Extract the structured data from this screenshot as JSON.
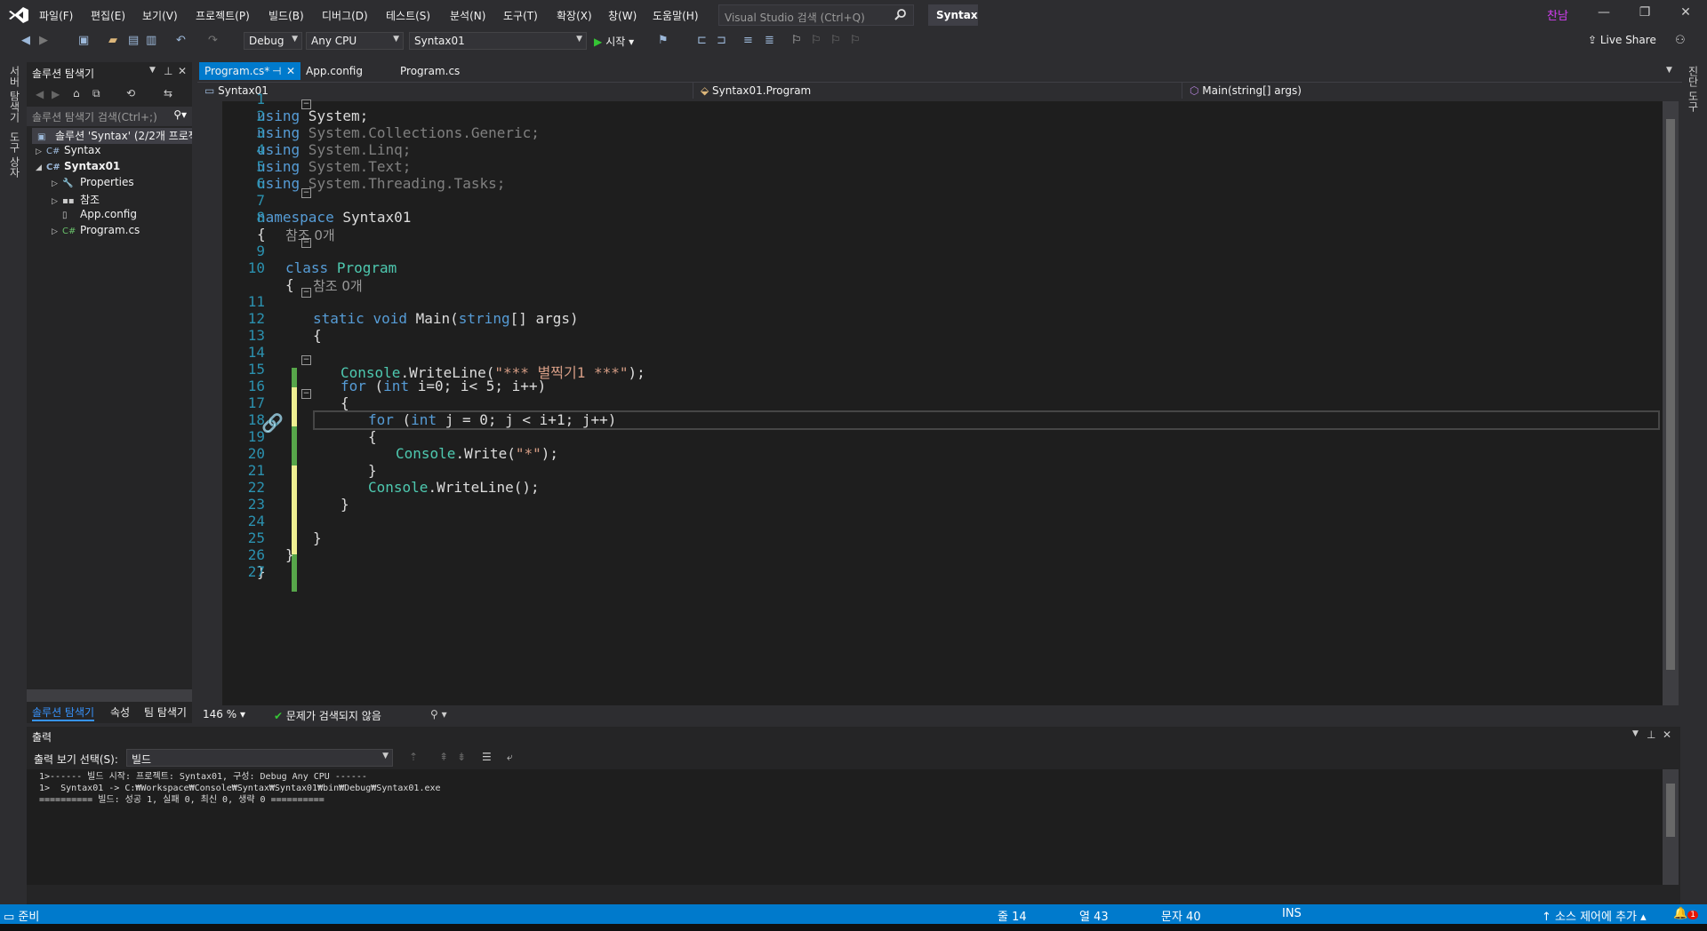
{
  "menu": [
    "파일(F)",
    "편집(E)",
    "보기(V)",
    "프로젝트(P)",
    "빌드(B)",
    "디버그(D)",
    "테스트(S)",
    "분석(N)",
    "도구(T)",
    "확장(X)",
    "창(W)",
    "도움말(H)"
  ],
  "search": {
    "placeholder": "Visual Studio 검색 (Ctrl+Q)"
  },
  "solution_name": "Syntax",
  "user": "찬남",
  "toolbar": {
    "config": "Debug",
    "platform": "Any CPU",
    "startup_project": "Syntax01",
    "start_label": "시작",
    "live_share": "Live Share"
  },
  "left_strip": {
    "server_explorer": "서버 탐색기",
    "toolbox": "도구 상자"
  },
  "right_strip": {
    "label": "진단 도구"
  },
  "solution_explorer": {
    "title": "솔루션 탐색기",
    "search_placeholder": "솔루션 탐색기 검색(Ctrl+;)",
    "root": "솔루션 'Syntax' (2/2개 프로젝트)",
    "items": [
      {
        "label": "Syntax",
        "level": 1,
        "expander": "▷",
        "icon": "C#"
      },
      {
        "label": "Syntax01",
        "level": 1,
        "expander": "◢",
        "icon": "C#"
      },
      {
        "label": "Properties",
        "level": 2,
        "expander": "▷",
        "icon": "🔧"
      },
      {
        "label": "참조",
        "level": 2,
        "expander": "▷",
        "icon": "▪▪"
      },
      {
        "label": "App.config",
        "level": 2,
        "expander": "",
        "icon": "▯"
      },
      {
        "label": "Program.cs",
        "level": 2,
        "expander": "▷",
        "icon": "C#"
      }
    ],
    "bottom_tabs": [
      "솔루션 탐색기",
      "속성",
      "팀 탐색기"
    ]
  },
  "doc_tabs": [
    {
      "label": "Program.cs*",
      "active": true
    },
    {
      "label": "App.config",
      "active": false
    },
    {
      "label": "Program.cs",
      "active": false
    }
  ],
  "navbar": {
    "project": "Syntax01",
    "class": "Syntax01.Program",
    "member": "Main(string[] args)"
  },
  "code_lines": [
    {
      "n": "1"
    },
    {
      "n": "2"
    },
    {
      "n": "3"
    },
    {
      "n": "4"
    },
    {
      "n": "5"
    },
    {
      "n": "6"
    },
    {
      "n": "7"
    },
    {
      "n": "8"
    },
    {
      "n": "9"
    },
    {
      "n": "10"
    },
    {
      "n": "11"
    },
    {
      "n": "12"
    },
    {
      "n": "13"
    },
    {
      "n": "14"
    },
    {
      "n": "15"
    },
    {
      "n": "16"
    },
    {
      "n": "17"
    },
    {
      "n": "18"
    },
    {
      "n": "19"
    },
    {
      "n": "20"
    },
    {
      "n": "21"
    },
    {
      "n": "22"
    },
    {
      "n": "23"
    },
    {
      "n": "24"
    },
    {
      "n": "25"
    },
    {
      "n": "26"
    },
    {
      "n": "27"
    }
  ],
  "code": {
    "l1": [
      "using",
      " System;"
    ],
    "l2": [
      "using",
      " System.Collections.Generic;"
    ],
    "l3": [
      "using",
      " System.Linq;"
    ],
    "l4": [
      "using",
      " System.Text;"
    ],
    "l5": [
      "using",
      " System.Threading.Tasks;"
    ],
    "l7": [
      "namespace",
      " Syntax01"
    ],
    "l8": "{",
    "ref1": "참조 0개",
    "l9": [
      "class",
      "Program"
    ],
    "l10": "{",
    "ref2": "참조 0개",
    "l11": [
      "static",
      "void",
      "Main(",
      "string",
      "[] args)"
    ],
    "l12": "{",
    "l14": [
      "Console",
      ".WriteLine(",
      "\"*** 별찍기1 ***\"",
      ");"
    ],
    "l15": [
      "for",
      " (",
      "int",
      " i=0; i< 5; i++)"
    ],
    "l16": "{",
    "l17": [
      "for",
      " (",
      "int",
      " j = 0; j < i+1; j++)"
    ],
    "l18": "{",
    "l19": [
      "Console",
      ".Write(",
      "\"*\"",
      ");"
    ],
    "l20": "}",
    "l21": [
      "Console",
      ".WriteLine();"
    ],
    "l22": "}",
    "l24": "}",
    "l25": "}",
    "l26": "}"
  },
  "editor_status": {
    "zoom": "146 %",
    "issues": "문제가 검색되지 않음"
  },
  "output": {
    "title": "출력",
    "select_label": "출력 보기 선택(S):",
    "source": "빌드",
    "lines": [
      "1>------ 빌드 시작: 프로젝트: Syntax01, 구성: Debug Any CPU ------",
      "1>  Syntax01 -> C:₩Workspace₩Console₩Syntax₩Syntax01₩bin₩Debug₩Syntax01.exe",
      "========== 빌드: 성공 1, 실패 0, 최신 0, 생략 0 =========="
    ]
  },
  "statusbar": {
    "ready": "준비",
    "line": "줄 14",
    "col": "열 43",
    "ch": "문자 40",
    "mode": "INS",
    "source_control": "소스 제어에 추가",
    "notifications": "1"
  },
  "colors": {
    "accent": "#007acc",
    "keyword": "#569cd6",
    "type": "#4ec9b0",
    "string": "#d69d85",
    "linenum": "#2b91af",
    "changed_saved": "#57a64a",
    "changed_unsaved": "#efef91"
  }
}
